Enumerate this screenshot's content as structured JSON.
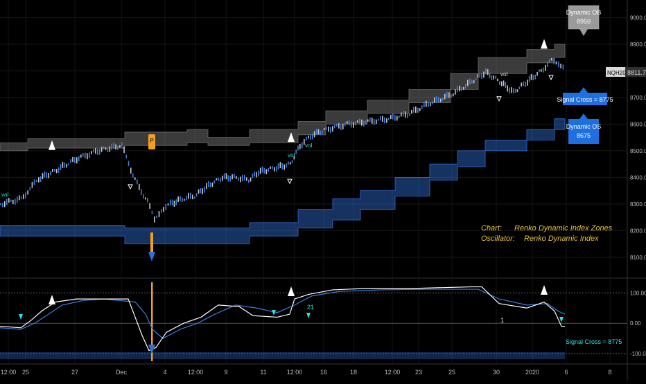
{
  "symbol": {
    "ticker": "NQH2020",
    "last_price": "8811.75"
  },
  "callouts": {
    "dynamic_ob": {
      "label": "Dynamic OB",
      "value": "8950"
    },
    "signal_cross": "Signal Cross = 8775",
    "dynamic_os": {
      "label": "Dynamic OS",
      "value": "8675"
    },
    "osc_signal_cross": "Signal Cross = 8775"
  },
  "annotation": {
    "line1_key": "Chart:",
    "line1_value": "Renko Dynamic Index Zones",
    "line2_key": "Oscillator:",
    "line2_value": "Renko Dynamic Index"
  },
  "markers": {
    "vol": "vol",
    "p": "P",
    "one": "1",
    "twentyone": "21"
  },
  "colors": {
    "background": "#000000",
    "price_up": "#3d7ddb",
    "price_down": "#c8c8c8",
    "os_zone": "#2f6fd6",
    "ob_zone": "#6b6b6b",
    "annotation": "#e8c33a",
    "signal": "#2ce0e0",
    "accent_orange": "#f0a020",
    "dynamic_os_box": "#1e6fe0"
  },
  "chart_data": [
    {
      "type": "line",
      "panel": "price",
      "series_style": "renko candles with dynamic zones",
      "y_ticks": [
        "9000.00",
        "8900.00",
        "8800.00",
        "8700.00",
        "8600.00",
        "8500.00",
        "8400.00",
        "8300.00",
        "8200.00",
        "8100.00"
      ],
      "ylim": [
        8040,
        9040
      ],
      "x_ticks": [
        "12:00",
        "25",
        "27",
        "Dec",
        "4",
        "12:00",
        "9",
        "11",
        "12:00",
        "16",
        "18",
        "12:00",
        "23",
        "25",
        "30",
        "2020",
        "6",
        "8"
      ],
      "price_path": [
        [
          0,
          8300
        ],
        [
          30,
          8320
        ],
        [
          55,
          8395
        ],
        [
          75,
          8420
        ],
        [
          110,
          8470
        ],
        [
          140,
          8500
        ],
        [
          175,
          8520
        ],
        [
          188,
          8430
        ],
        [
          200,
          8360
        ],
        [
          212,
          8310
        ],
        [
          222,
          8240
        ],
        [
          232,
          8280
        ],
        [
          245,
          8300
        ],
        [
          262,
          8320
        ],
        [
          280,
          8330
        ],
        [
          300,
          8370
        ],
        [
          320,
          8400
        ],
        [
          340,
          8400
        ],
        [
          358,
          8390
        ],
        [
          372,
          8420
        ],
        [
          395,
          8435
        ],
        [
          418,
          8450
        ],
        [
          432,
          8520
        ],
        [
          450,
          8560
        ],
        [
          470,
          8580
        ],
        [
          500,
          8600
        ],
        [
          530,
          8610
        ],
        [
          560,
          8620
        ],
        [
          590,
          8640
        ],
        [
          620,
          8680
        ],
        [
          650,
          8710
        ],
        [
          680,
          8760
        ],
        [
          700,
          8795
        ],
        [
          720,
          8760
        ],
        [
          740,
          8720
        ],
        [
          760,
          8760
        ],
        [
          780,
          8800
        ],
        [
          795,
          8840
        ],
        [
          805,
          8830
        ],
        [
          815,
          8812
        ]
      ],
      "ob_upper": [
        [
          0,
          8530
        ],
        [
          40,
          8530
        ],
        [
          40,
          8545
        ],
        [
          180,
          8545
        ],
        [
          180,
          8570
        ],
        [
          270,
          8570
        ],
        [
          270,
          8580
        ],
        [
          300,
          8580
        ],
        [
          300,
          8550
        ],
        [
          360,
          8550
        ],
        [
          360,
          8580
        ],
        [
          430,
          8580
        ],
        [
          430,
          8610
        ],
        [
          470,
          8610
        ],
        [
          470,
          8650
        ],
        [
          530,
          8650
        ],
        [
          530,
          8690
        ],
        [
          590,
          8690
        ],
        [
          590,
          8730
        ],
        [
          650,
          8730
        ],
        [
          650,
          8790
        ],
        [
          690,
          8790
        ],
        [
          690,
          8850
        ],
        [
          760,
          8850
        ],
        [
          760,
          8880
        ],
        [
          800,
          8880
        ],
        [
          800,
          8900
        ],
        [
          815,
          8900
        ]
      ],
      "ob_lower": [
        [
          0,
          8500
        ],
        [
          40,
          8500
        ],
        [
          40,
          8510
        ],
        [
          180,
          8510
        ],
        [
          180,
          8520
        ],
        [
          270,
          8520
        ],
        [
          270,
          8530
        ],
        [
          300,
          8530
        ],
        [
          300,
          8520
        ],
        [
          360,
          8520
        ],
        [
          360,
          8530
        ],
        [
          430,
          8530
        ],
        [
          430,
          8560
        ],
        [
          470,
          8560
        ],
        [
          470,
          8600
        ],
        [
          530,
          8600
        ],
        [
          530,
          8640
        ],
        [
          590,
          8640
        ],
        [
          590,
          8680
        ],
        [
          650,
          8680
        ],
        [
          650,
          8730
        ],
        [
          690,
          8730
        ],
        [
          690,
          8790
        ],
        [
          760,
          8790
        ],
        [
          760,
          8830
        ],
        [
          800,
          8830
        ],
        [
          800,
          8850
        ],
        [
          815,
          8850
        ]
      ],
      "os_upper": [
        [
          0,
          8220
        ],
        [
          180,
          8220
        ],
        [
          180,
          8210
        ],
        [
          360,
          8210
        ],
        [
          360,
          8230
        ],
        [
          430,
          8230
        ],
        [
          430,
          8280
        ],
        [
          480,
          8280
        ],
        [
          480,
          8320
        ],
        [
          520,
          8320
        ],
        [
          520,
          8350
        ],
        [
          570,
          8350
        ],
        [
          570,
          8400
        ],
        [
          620,
          8400
        ],
        [
          620,
          8450
        ],
        [
          660,
          8450
        ],
        [
          660,
          8500
        ],
        [
          700,
          8500
        ],
        [
          700,
          8540
        ],
        [
          760,
          8540
        ],
        [
          760,
          8580
        ],
        [
          800,
          8580
        ],
        [
          800,
          8620
        ],
        [
          815,
          8620
        ]
      ],
      "os_lower": [
        [
          0,
          8180
        ],
        [
          180,
          8180
        ],
        [
          180,
          8150
        ],
        [
          360,
          8150
        ],
        [
          360,
          8180
        ],
        [
          430,
          8180
        ],
        [
          430,
          8210
        ],
        [
          480,
          8210
        ],
        [
          480,
          8240
        ],
        [
          520,
          8240
        ],
        [
          520,
          8280
        ],
        [
          570,
          8280
        ],
        [
          570,
          8330
        ],
        [
          620,
          8330
        ],
        [
          620,
          8390
        ],
        [
          660,
          8390
        ],
        [
          660,
          8440
        ],
        [
          700,
          8440
        ],
        [
          700,
          8500
        ],
        [
          760,
          8500
        ],
        [
          760,
          8540
        ],
        [
          800,
          8540
        ],
        [
          800,
          8580
        ],
        [
          815,
          8580
        ]
      ],
      "up_arrows_x": [
        75,
        420,
        785
      ],
      "down_arrows_x": [
        188,
        418,
        720,
        795
      ]
    },
    {
      "type": "line",
      "panel": "oscillator",
      "y_ticks": [
        "100.00",
        "0.00",
        "-100.00"
      ],
      "ylim": [
        -125,
        135
      ],
      "levels": [
        100,
        0,
        -100
      ],
      "fast": [
        [
          0,
          -10
        ],
        [
          30,
          -15
        ],
        [
          45,
          10
        ],
        [
          60,
          40
        ],
        [
          80,
          70
        ],
        [
          110,
          80
        ],
        [
          140,
          80
        ],
        [
          185,
          80
        ],
        [
          195,
          20
        ],
        [
          205,
          -40
        ],
        [
          215,
          -90
        ],
        [
          225,
          -80
        ],
        [
          240,
          -30
        ],
        [
          265,
          0
        ],
        [
          290,
          20
        ],
        [
          315,
          60
        ],
        [
          345,
          55
        ],
        [
          365,
          25
        ],
        [
          400,
          20
        ],
        [
          418,
          30
        ],
        [
          425,
          80
        ],
        [
          445,
          95
        ],
        [
          480,
          110
        ],
        [
          530,
          115
        ],
        [
          600,
          115
        ],
        [
          680,
          120
        ],
        [
          695,
          120
        ],
        [
          720,
          65
        ],
        [
          760,
          50
        ],
        [
          785,
          70
        ],
        [
          800,
          40
        ],
        [
          810,
          -10
        ],
        [
          815,
          -10
        ]
      ],
      "slow": [
        [
          0,
          -15
        ],
        [
          30,
          -20
        ],
        [
          50,
          0
        ],
        [
          70,
          30
        ],
        [
          90,
          60
        ],
        [
          120,
          75
        ],
        [
          150,
          80
        ],
        [
          195,
          70
        ],
        [
          210,
          30
        ],
        [
          220,
          -20
        ],
        [
          235,
          -50
        ],
        [
          260,
          -20
        ],
        [
          285,
          0
        ],
        [
          310,
          30
        ],
        [
          340,
          60
        ],
        [
          370,
          50
        ],
        [
          400,
          35
        ],
        [
          425,
          60
        ],
        [
          450,
          90
        ],
        [
          490,
          105
        ],
        [
          550,
          110
        ],
        [
          620,
          112
        ],
        [
          690,
          112
        ],
        [
          720,
          80
        ],
        [
          760,
          60
        ],
        [
          790,
          65
        ],
        [
          805,
          40
        ],
        [
          815,
          30
        ]
      ]
    }
  ]
}
